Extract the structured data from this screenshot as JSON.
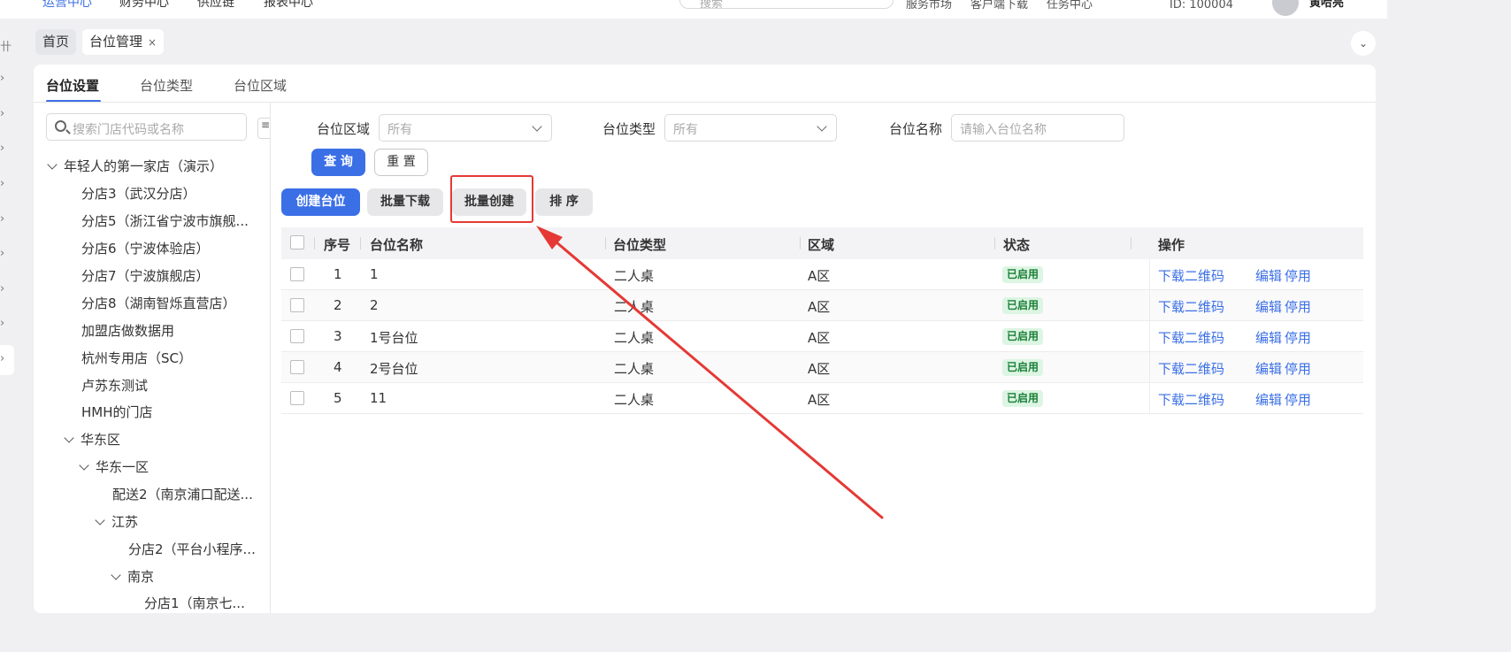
{
  "header": {
    "nav": [
      "运营中心",
      "财务中心",
      "供应链",
      "报表中心"
    ],
    "search_placeholder": "搜索",
    "links": [
      "服务市场",
      "客户端下载",
      "任务中心"
    ],
    "account_id": "ID: 100004",
    "user_name": "黄哈亮"
  },
  "page_tabs": [
    {
      "label": "首页"
    },
    {
      "label": "台位管理",
      "close": "×"
    }
  ],
  "collapse_icon": "chevron-down",
  "sub_tabs": [
    "台位设置",
    "台位类型",
    "台位区域"
  ],
  "tree": {
    "search_placeholder": "搜索门店代码或名称",
    "root": "年轻人的第一家店（演示）",
    "items": [
      "分店3（武汉分店）",
      "分店5（浙江省宁波市旗舰...",
      "分店6（宁波体验店）",
      "分店7（宁波旗舰店）",
      "分店8（湖南智烁直营店）",
      "加盟店做数据用",
      "杭州专用店（SC）",
      "卢苏东测试",
      "HMH的门店",
      "华东区",
      "华东一区",
      "配送2（南京浦口配送...",
      "江苏",
      "分店2（平台小程序...",
      "南京",
      "分店1（南京七..."
    ]
  },
  "filters": {
    "area_label": "台位区域",
    "area_value": "所有",
    "type_label": "台位类型",
    "type_value": "所有",
    "name_label": "台位名称",
    "name_placeholder": "请输入台位名称",
    "query_button": "查 询",
    "reset_button": "重 置"
  },
  "actions": {
    "create": "创建台位",
    "batch_download": "批量下载",
    "batch_create": "批量创建",
    "sort": "排 序"
  },
  "table": {
    "columns": [
      "序号",
      "台位名称",
      "台位类型",
      "区域",
      "状态",
      "操作"
    ],
    "rows": [
      {
        "no": "1",
        "name": "1",
        "type": "二人桌",
        "area": "A区",
        "status": "已启用"
      },
      {
        "no": "2",
        "name": "2",
        "type": "二人桌",
        "area": "A区",
        "status": "已启用"
      },
      {
        "no": "3",
        "name": "1号台位",
        "type": "二人桌",
        "area": "A区",
        "status": "已启用"
      },
      {
        "no": "4",
        "name": "2号台位",
        "type": "二人桌",
        "area": "A区",
        "status": "已启用"
      },
      {
        "no": "5",
        "name": "11",
        "type": "二人桌",
        "area": "A区",
        "status": "已启用"
      }
    ],
    "ops": [
      "下载二维码",
      "编辑",
      "停用"
    ]
  },
  "colors": {
    "accent": "#3b6fe6",
    "highlight": "#e53935",
    "status_bg": "#ddf5e3",
    "status_fg": "#1a7f37"
  }
}
